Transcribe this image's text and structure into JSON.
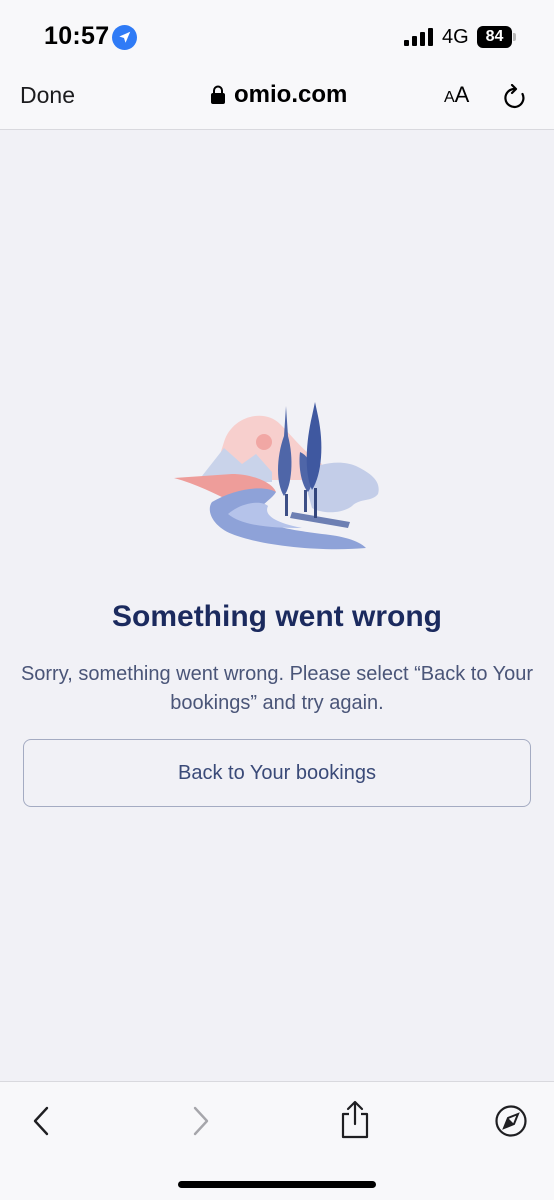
{
  "status_bar": {
    "time": "10:57",
    "network": "4G",
    "battery": "84",
    "icons": [
      "location-arrow-icon",
      "signal-bars-icon",
      "battery-icon"
    ]
  },
  "browser": {
    "done_label": "Done",
    "url": "omio.com",
    "text_size_small": "A",
    "text_size_large": "A",
    "icons": [
      "lock-icon",
      "reload-icon"
    ]
  },
  "content": {
    "title": "Something went wrong",
    "message": "Sorry, something went wrong. Please select “Back to Your bookings” and try again.",
    "button_label": "Back to Your bookings",
    "illustration": "landscape-illustration"
  },
  "toolbar": {
    "icons": [
      "back-chevron-icon",
      "forward-chevron-icon",
      "share-icon",
      "compass-icon"
    ]
  },
  "colors": {
    "background": "#f1f1f6",
    "title": "#1b2a5e",
    "text": "#4a5578",
    "button_border": "#a4abc2",
    "accent_blue": "#2f7bf6"
  }
}
